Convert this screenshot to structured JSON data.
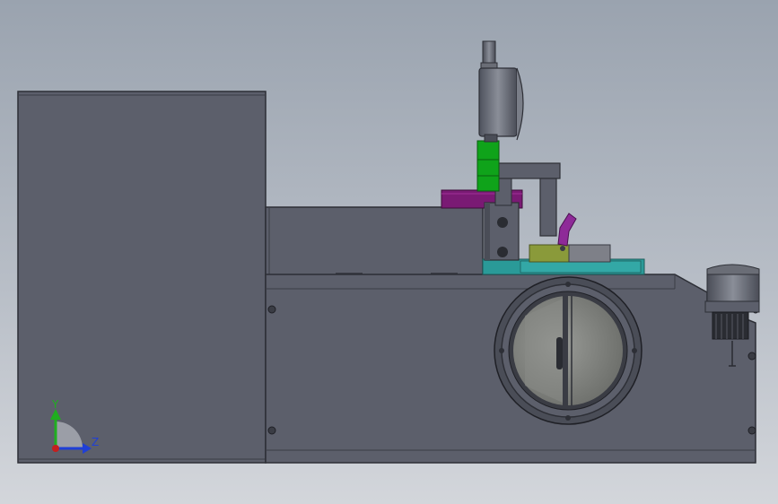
{
  "triad": {
    "y_label": "Y",
    "z_label": "Z",
    "y_color": "#1fae1f",
    "z_color": "#1f3fd6",
    "x_color": "#c41f1f"
  },
  "colors": {
    "body": "#5c5f6b",
    "body_edge": "#2d2f36",
    "green_part": "#0fa31a",
    "purple_part": "#7a1a74",
    "teal_part": "#2a9a98",
    "olive_part": "#8a9a3a",
    "bent_arm": "#8e2a98"
  }
}
